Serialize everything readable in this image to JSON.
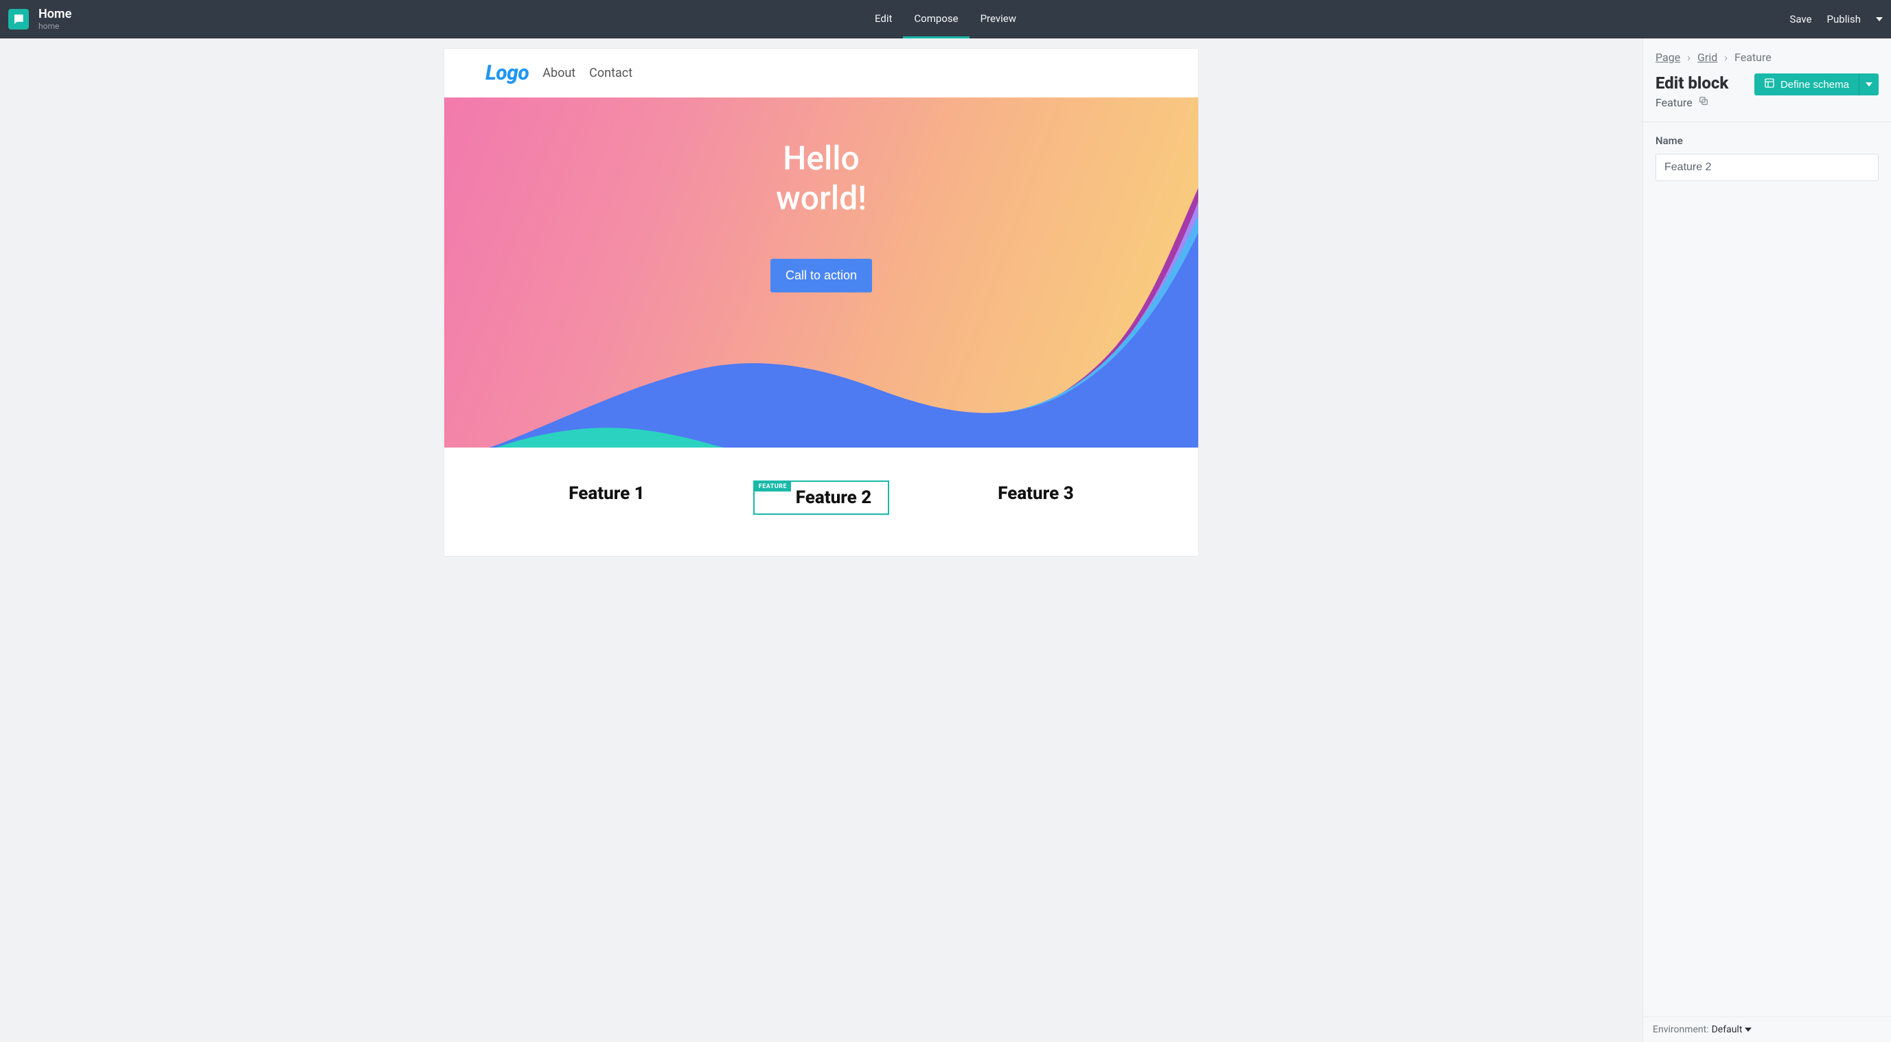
{
  "header": {
    "page_title": "Home",
    "page_slug": "home",
    "tabs": {
      "edit": "Edit",
      "compose": "Compose",
      "preview": "Preview"
    },
    "active_tab": "compose",
    "actions": {
      "save": "Save",
      "publish": "Publish"
    }
  },
  "canvas": {
    "nav": {
      "logo": "Logo",
      "links": [
        "About",
        "Contact"
      ]
    },
    "hero": {
      "title_line1": "Hello",
      "title_line2": "world!",
      "cta": "Call to action"
    },
    "features": {
      "items": [
        "Feature 1",
        "Feature 2",
        "Feature 3"
      ],
      "selected_index": 1,
      "tag_label": "FEATURE"
    }
  },
  "sidebar": {
    "breadcrumb": {
      "page": "Page",
      "grid": "Grid",
      "current": "Feature"
    },
    "edit_block_title": "Edit block",
    "edit_block_subtitle": "Feature",
    "define_schema_label": "Define schema",
    "fields": {
      "name_label": "Name",
      "name_value": "Feature 2"
    },
    "footer": {
      "env_label": "Environment:",
      "env_value": "Default"
    }
  }
}
